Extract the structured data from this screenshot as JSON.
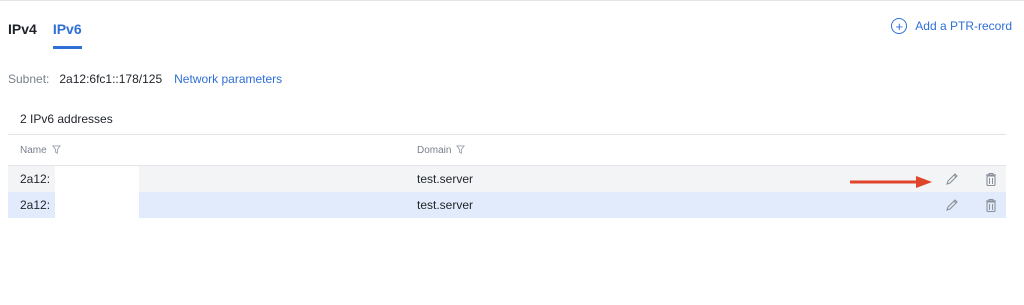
{
  "tabs": [
    {
      "label": "IPv4",
      "active": false
    },
    {
      "label": "IPv6",
      "active": true
    }
  ],
  "actions": {
    "add_ptr_label": "Add a PTR-record"
  },
  "subnet": {
    "label": "Subnet:",
    "value": "2a12:6fc1::178/125",
    "link": "Network parameters"
  },
  "addresses": {
    "count_label": "2 IPv6 addresses"
  },
  "table": {
    "columns": [
      "Name",
      "Domain"
    ],
    "rows": [
      {
        "name": "2a12:",
        "domain": "test.server",
        "highlighted": false
      },
      {
        "name": "2a12:",
        "domain": "test.server",
        "highlighted": true
      }
    ]
  },
  "colors": {
    "accent": "#2f6fd6",
    "row_highlight": "#e2ebfb",
    "annotation_arrow": "#e0452b"
  },
  "icons": [
    "plus-circle-icon",
    "filter-icon",
    "pencil-icon",
    "trash-icon",
    "arrow-annotation"
  ]
}
